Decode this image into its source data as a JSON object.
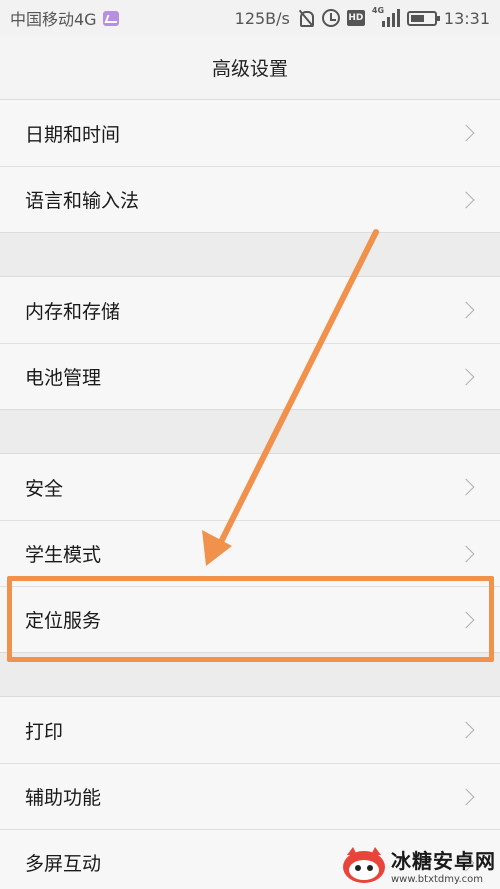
{
  "status_bar": {
    "carrier": "中国移动4G",
    "speed": "125B/s",
    "time": "13:31",
    "network_tag": "4G",
    "hd_tag": "HD"
  },
  "header": {
    "title": "高级设置"
  },
  "groups": [
    {
      "items": [
        {
          "label": "日期和时间"
        },
        {
          "label": "语言和输入法"
        }
      ]
    },
    {
      "items": [
        {
          "label": "内存和存储"
        },
        {
          "label": "电池管理"
        }
      ]
    },
    {
      "items": [
        {
          "label": "安全"
        },
        {
          "label": "学生模式"
        },
        {
          "label": "定位服务"
        }
      ]
    },
    {
      "items": [
        {
          "label": "打印"
        },
        {
          "label": "辅助功能"
        },
        {
          "label": "多屏互动"
        }
      ]
    }
  ],
  "annotation": {
    "color": "#f0924c"
  },
  "watermark": {
    "title": "冰糖安卓网",
    "url": "www.btxtdmy.com"
  }
}
